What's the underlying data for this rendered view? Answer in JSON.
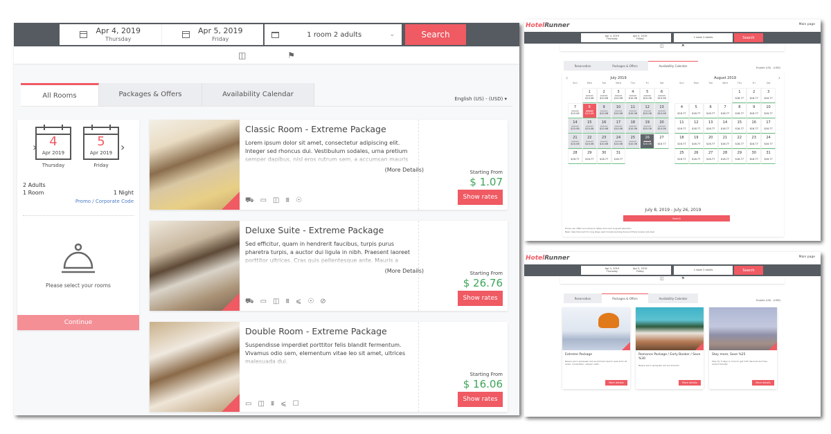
{
  "main": {
    "search": {
      "checkin": {
        "date": "Apr 4, 2019",
        "weekday": "Thursday"
      },
      "checkout": {
        "date": "Apr 5, 2019",
        "weekday": "Friday"
      },
      "rooms_guests": "1 room 2 adults",
      "search_label": "Search"
    },
    "icons": [
      "pets-icon-tray",
      "pets-icon-dog"
    ],
    "tabs": [
      {
        "label": "All Rooms",
        "active": true
      },
      {
        "label": "Packages & Offers",
        "active": false
      },
      {
        "label": "Availability Calendar",
        "active": false
      }
    ],
    "language": "English (US) - (USD)",
    "summary": {
      "checkin": {
        "day": "4",
        "month_year": "Apr 2019",
        "weekday": "Thursday"
      },
      "checkout": {
        "day": "5",
        "month_year": "Apr 2019",
        "weekday": "Friday"
      },
      "adults": "2 Adults",
      "rooms": "1 Room",
      "nights": "1 Night",
      "promo": "Promo / Corporate Code",
      "empty_message": "Please select your rooms",
      "continue_label": "Continue"
    },
    "rooms": [
      {
        "title": "Classic Room - Extreme Package",
        "description": "Lorem ipsum dolor sit amet, consectetur adipiscing elit. Integer sed rhoncus dui. Vestibulum sodales, urna pretium semper dapibus, nisl eros rutrum sem, a accumsan mauris ligula ut",
        "more": "(More Details)",
        "starting_from": "Starting From",
        "price": "$ 1.07",
        "button": "Show rates",
        "amenities": [
          "car-icon",
          "tv-icon",
          "phone-icon",
          "ac-icon",
          "idea-icon"
        ]
      },
      {
        "title": "Deluxe Suite - Extreme Package",
        "description": "Sed efficitur, quam in hendrerit faucibus, turpis purus pharetra turpis, a auctor dui ligula in nibh. Praesent laoreet porttitor ultrices. Cras quis pellentesque ante. Mauris a ullamcorper ante.",
        "more": "(More Details)",
        "starting_from": "Starting From",
        "price": "$ 26.76",
        "button": "Show rates",
        "amenities": [
          "car-icon",
          "tv-icon",
          "phone-icon",
          "ac-icon",
          "hairdryer-icon",
          "idea-icon",
          "no-smoking-icon"
        ]
      },
      {
        "title": "Double Room - Extreme Package",
        "description": "Suspendisse imperdiet porttitor felis blandit fermentum. Vivamus odio sem, elementum vitae leo sit amet, ultrices malesuada dui.",
        "more": "",
        "starting_from": "Starting From",
        "price": "$ 16.06",
        "button": "Show rates",
        "amenities": [
          "tv-icon",
          "phone-icon",
          "ac-icon",
          "hairdryer-icon",
          "safe-icon"
        ]
      }
    ]
  },
  "mini": {
    "logo_a": "Hotel",
    "logo_b": "Runner",
    "main_page": "Main page",
    "search": {
      "checkin": "Apr 4, 2019",
      "checkin_day": "Thursday",
      "checkout": "Apr 5, 2019",
      "checkout_day": "Friday",
      "rooms_guests": "1 room 2 adults",
      "search_label": "Search"
    },
    "tabs": [
      "Reservation",
      "Packages & Offers",
      "Availability Calendar"
    ],
    "language": "English (US) - (USD)"
  },
  "calendar": {
    "dow": [
      "Sun",
      "Mon",
      "Tue",
      "Wed",
      "Thu",
      "Fri",
      "Sat"
    ],
    "months": [
      {
        "name": "July 2019",
        "offset": 1,
        "days": 31,
        "old_price": "$16.77",
        "deal_price": "$10.06",
        "deal_until": 26,
        "plain_price": "$16.77"
      },
      {
        "name": "August 2019",
        "offset": 4,
        "days": 31,
        "old_price": "",
        "deal_price": "",
        "deal_until": 0,
        "plain_price": "$16.77"
      }
    ],
    "range_start": 8,
    "range_end": 26,
    "range_label": "July 8, 2019 - July 26, 2019",
    "search_label": "Search",
    "note1": "Prices can differ according to dates and room & guest selection.",
    "note2": "Basic deal  Discount for long stays  Last minute booking discount  Early booker  Job deal"
  },
  "packages": [
    {
      "title": "Extreme Package",
      "text": "Neque porro quisquam est qui dolorem ipsum quia dolor sit amet, consectetur, adipisci velit...",
      "button": "More details"
    },
    {
      "title": "Romance Package / Early Booker / Save %30",
      "text": "Neque porro quisquam est qui dolorem",
      "button": "More details"
    },
    {
      "title": "Stay more, Save %25",
      "text": "Stay for 5 days or more to get %25 discount and free airport transfer",
      "button": "More details"
    }
  ]
}
